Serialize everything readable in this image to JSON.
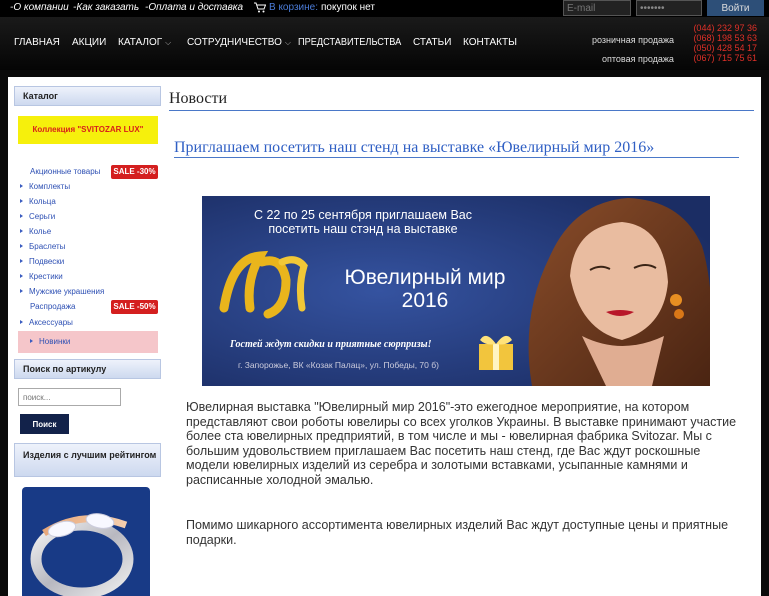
{
  "topbar": {
    "links": [
      "-О компании",
      "-Как заказать",
      "-Оплата и доставка"
    ],
    "cart_label": "В корзине:",
    "cart_value": "покупок нет",
    "email_placeholder": "E-mail",
    "password_value": "•••••••",
    "login_label": "Войти"
  },
  "header": {
    "nav": [
      {
        "label": "ГЛАВНАЯ"
      },
      {
        "label": "АКЦИИ"
      },
      {
        "label": "КАТАЛОГ",
        "dropdown": true
      },
      {
        "label": "СОТРУДНИЧЕСТВО",
        "dropdown": true
      },
      {
        "label": "ПРЕДСТАВИТЕЛЬСТВА"
      },
      {
        "label": "СТАТЬИ"
      },
      {
        "label": "КОНТАКТЫ"
      }
    ],
    "retail_label": "розничная продажа",
    "wholesale_label": "оптовая продажа",
    "phones": [
      "(044) 232 97 36",
      "(068) 198 53 63",
      "(050) 428 54 17",
      "(067) 715 75 61"
    ],
    "phone_color": "#e03028"
  },
  "sidebar": {
    "catalog_title": "Каталог",
    "lux_label": "Коллекция \"SVITOZAR LUX\"",
    "items": [
      {
        "label": "Акционные товары",
        "badge": "SALE -30%"
      },
      {
        "label": "Комплекты"
      },
      {
        "label": "Кольца"
      },
      {
        "label": "Серьги"
      },
      {
        "label": "Колье"
      },
      {
        "label": "Браслеты"
      },
      {
        "label": "Подвески"
      },
      {
        "label": "Крестики"
      },
      {
        "label": "Мужские украшения"
      },
      {
        "label": "Распродажа",
        "badge": "SALE -50%"
      },
      {
        "label": "Аксессуары"
      }
    ],
    "new_label": "Новинки",
    "sku_title": "Поиск по артикулу",
    "sku_placeholder": "поиск...",
    "sku_button": "Поиск",
    "rated_title": "Изделия с лучшим рейтингом"
  },
  "main": {
    "title": "Новости",
    "post_title": "Приглашаем посетить наш стенд на выставке «Ювелирный мир 2016»",
    "banner": {
      "line1": "С 22 по 25 сентября приглашаем Вас",
      "line2": "посетить наш стэнд на выставке",
      "event_name": "Ювелирный мир",
      "event_year": "2016",
      "promo": "Гостей ждут скидки и приятные сюрпризы!",
      "address": "г. Запорожье, ВК «Козак Палац», ул. Победы, 70 б)"
    },
    "paragraph1": "Ювелирная выставка \"Ювелирный мир 2016\"-это ежегодное мероприятие, на котором представляют свои роботы ювелиры со всех уголков Украины. В выставке принимают участие более ста ювелирных предприятий, в том числе и мы - ювелирная фабрика Svitozar. Мы с большим удовольствием приглашаем Вас посетить наш стенд, где Вас ждут роскошные модели ювелирных изделий из серебра и золотыми вставками, усыпанные камнями и расписанные холодной эмалью.",
    "paragraph2": "Помимо шикарного ассортимента ювелирных изделий Вас ждут доступные цены и приятные подарки."
  }
}
